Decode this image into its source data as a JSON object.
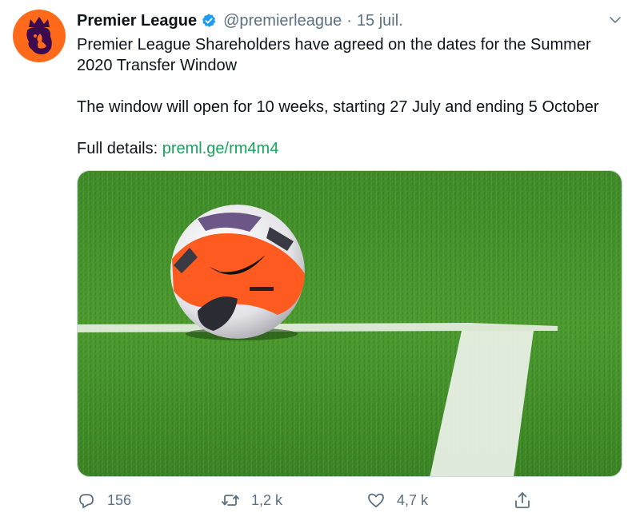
{
  "tweet": {
    "display_name": "Premier League",
    "handle": "@premierleague",
    "separator": "·",
    "timestamp": "15 juil.",
    "text_line1": "Premier League Shareholders have agreed on the dates for the Summer 2020 Transfer Window",
    "text_line2": "The window will open for 10 weeks, starting 27 July and ending 5 October",
    "details_prefix": "Full details: ",
    "details_link": "preml.ge/rm4m4"
  },
  "actions": {
    "reply_count": "156",
    "retweet_count": "1,2 k",
    "like_count": "4,7 k"
  },
  "colors": {
    "avatar_bg": "#ff6a1a",
    "link": "#17a55a",
    "verified": "#1d9bf0",
    "muted": "#5b7083"
  },
  "icons": {
    "avatar": "premier-league-lion-icon",
    "verified": "verified-badge-icon",
    "caret": "chevron-down-icon",
    "reply": "reply-bubble-icon",
    "retweet": "retweet-icon",
    "like": "heart-icon",
    "share": "share-icon"
  }
}
